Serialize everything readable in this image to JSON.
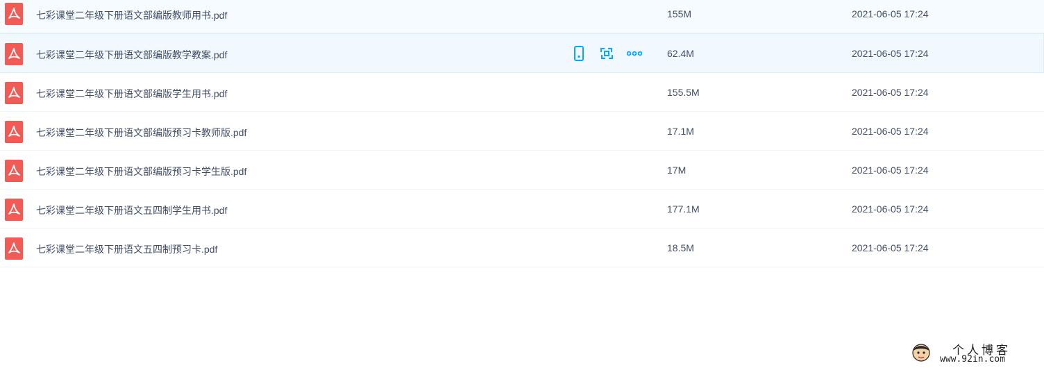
{
  "files": [
    {
      "name": "七彩课堂二年级下册语文部编版教师用书.pdf",
      "size": "155M",
      "date": "2021-06-05 17:24"
    },
    {
      "name": "七彩课堂二年级下册语文部编版教学教案.pdf",
      "size": "62.4M",
      "date": "2021-06-05 17:24"
    },
    {
      "name": "七彩课堂二年级下册语文部编版学生用书.pdf",
      "size": "155.5M",
      "date": "2021-06-05 17:24"
    },
    {
      "name": "七彩课堂二年级下册语文部编版预习卡教师版.pdf",
      "size": "17.1M",
      "date": "2021-06-05 17:24"
    },
    {
      "name": "七彩课堂二年级下册语文部编版预习卡学生版.pdf",
      "size": "17M",
      "date": "2021-06-05 17:24"
    },
    {
      "name": "七彩课堂二年级下册语文五四制学生用书.pdf",
      "size": "177.1M",
      "date": "2021-06-05 17:24"
    },
    {
      "name": "七彩课堂二年级下册语文五四制预习卡.pdf",
      "size": "18.5M",
      "date": "2021-06-05 17:24"
    }
  ],
  "row_actions": [
    {
      "icon": "phone-icon"
    },
    {
      "icon": "share-icon"
    },
    {
      "icon": "more-icon"
    }
  ],
  "watermark": {
    "title": "个人博客",
    "url": "www.92in.com"
  },
  "colors": {
    "pdf_red": "#f25a55",
    "accent": "#06a7ff",
    "text": "#424e67",
    "hover_bg": "#f2f9fe"
  }
}
